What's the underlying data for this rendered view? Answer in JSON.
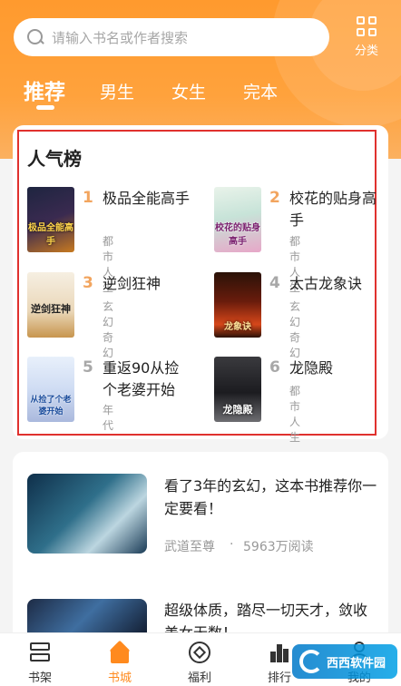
{
  "search": {
    "placeholder": "请输入书名或作者搜索"
  },
  "category": {
    "label": "分类"
  },
  "tabs": [
    {
      "label": "推荐",
      "active": true
    },
    {
      "label": "男生",
      "active": false
    },
    {
      "label": "女生",
      "active": false
    },
    {
      "label": "完本",
      "active": false
    }
  ],
  "ranking": {
    "title": "人气榜",
    "books": [
      {
        "rank": "1",
        "title": "极品全能高手",
        "category": "都市人生",
        "cover_text": "极品全能高手",
        "rank_color": "#f2a55f"
      },
      {
        "rank": "2",
        "title": "校花的贴身高手",
        "category": "都市人生",
        "cover_text": "校花的贴身高手",
        "rank_color": "#f2a55f"
      },
      {
        "rank": "3",
        "title": "逆剑狂神",
        "category": "玄幻奇幻",
        "cover_text": "逆剑狂神",
        "rank_color": "#f2a55f"
      },
      {
        "rank": "4",
        "title": "太古龙象诀",
        "category": "玄幻奇幻",
        "cover_text": "龙象诀",
        "rank_color": "#a8a8a8"
      },
      {
        "rank": "5",
        "title": "重返90从捡个老婆开始",
        "category": "年代",
        "cover_text": "从捡了个老婆开始",
        "rank_color": "#a8a8a8"
      },
      {
        "rank": "6",
        "title": "龙隐殿",
        "category": "都市人生",
        "cover_text": "龙隐殿",
        "rank_color": "#a8a8a8"
      }
    ]
  },
  "feed": [
    {
      "desc": "看了3年的玄幻，这本书推荐你一定要看！",
      "book": "武道至尊",
      "dot": "·",
      "reads": "5963万阅读"
    },
    {
      "desc": "超级体质，踏尽一切天才，敛收美女无数！",
      "book": "",
      "dot": "",
      "reads": ""
    }
  ],
  "bottom_nav": [
    {
      "label": "书架",
      "icon": "bookshelf-icon",
      "active": false
    },
    {
      "label": "书城",
      "icon": "home-icon",
      "active": true
    },
    {
      "label": "福利",
      "icon": "gift-icon",
      "active": false
    },
    {
      "label": "排行",
      "icon": "rank-icon",
      "active": false
    },
    {
      "label": "我的",
      "icon": "user-icon",
      "active": false
    }
  ],
  "watermark": {
    "text": "西西软件园"
  },
  "colors": {
    "accent": "#ff9a2e",
    "highlight_border": "#e0312e"
  }
}
